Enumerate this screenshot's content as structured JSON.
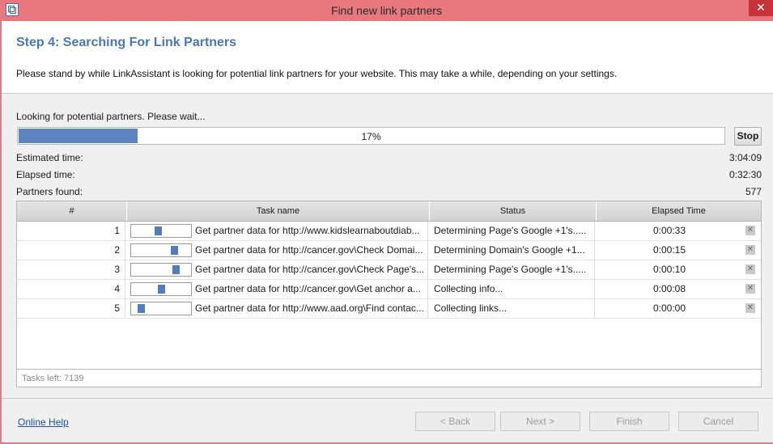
{
  "window": {
    "title": "Find new link partners",
    "close_glyph": "✕",
    "icon": "app-icon"
  },
  "header": {
    "step_title": "Step 4:  Searching For Link Partners",
    "description": "Please stand by while LinkAssistant is looking for potential link partners for your website. This may take a while, depending on your settings."
  },
  "progress": {
    "status_text": "Looking for potential partners. Please wait...",
    "percent_label": "17%",
    "percent_value": 17,
    "stop_label": "Stop",
    "bar_color": "#5b83bf"
  },
  "stats": {
    "estimated_label": "Estimated time:",
    "estimated_value": "3:04:09",
    "elapsed_label": "Elapsed time:",
    "elapsed_value": "0:32:30",
    "partners_label": "Partners found:",
    "partners_value": "577"
  },
  "table": {
    "headers": [
      "#",
      "Task name",
      "Status",
      "Elapsed Time"
    ],
    "rows": [
      {
        "num": "1",
        "task": "Get partner data for http://www.kidslearnaboutdiab...",
        "status": "Determining Page's Google +1's.....",
        "elapsed": "0:00:33",
        "activity": 0.45
      },
      {
        "num": "2",
        "task": "Get partner data for http://cancer.gov\\Check Domai...",
        "status": "Determining Domain's Google +1...",
        "elapsed": "0:00:15",
        "activity": 0.75
      },
      {
        "num": "3",
        "task": "Get partner data for http://cancer.gov\\Check Page's...",
        "status": "Determining Page's Google +1's.....",
        "elapsed": "0:00:10",
        "activity": 0.78
      },
      {
        "num": "4",
        "task": "Get partner data for http://cancer.gov\\Get anchor a...",
        "status": "Collecting info...",
        "elapsed": "0:00:08",
        "activity": 0.5
      },
      {
        "num": "5",
        "task": "Get partner data for http://www.aad.org\\Find contac...",
        "status": "Collecting links...",
        "elapsed": "0:00:00",
        "activity": 0.12
      }
    ],
    "remove_glyph": "✕",
    "tasks_left": "Tasks left: 7139"
  },
  "footer": {
    "online_help": "Online Help",
    "back": "< Back",
    "next": "Next >",
    "finish": "Finish",
    "cancel": "Cancel"
  }
}
